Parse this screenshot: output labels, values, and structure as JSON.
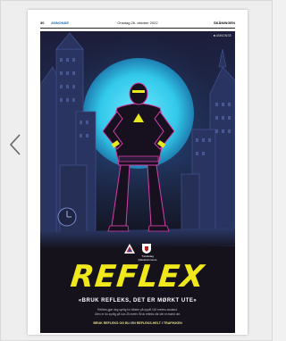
{
  "navigation": {
    "prev_icon": "chevron-left-icon"
  },
  "masthead": {
    "page_number": "30",
    "section": "ANNONSE",
    "date": "Onsdag 26. oktober 2022",
    "paper": "SKÅNINGEN"
  },
  "ad": {
    "advertiser_label": "■ ANNONSE",
    "logos": [
      {
        "name": "triangle-logo",
        "text": ""
      },
      {
        "name": "crest-logo",
        "text": "Trøndelag fylkeskommune"
      }
    ],
    "headline": "REFLEX",
    "tagline": "«BRUK REFLEKS, DET ER MØRKT UTE»",
    "body_lines": [
      "Refleks gjør deg synlig for bilister på opptil 140 meters avstand.",
      "Uten er du synlig på kun 25 meter. Bruk refleks når det er mørkt ute."
    ],
    "footer_line": "BRUK REFLEKS OG BLI EN REFLEKS-HELT I TRAFIKKEN",
    "colors": {
      "headline": "#f1e81c",
      "moon": "#39d7f2",
      "suit": "#16101f",
      "neon_accent": "#e8e820"
    }
  }
}
